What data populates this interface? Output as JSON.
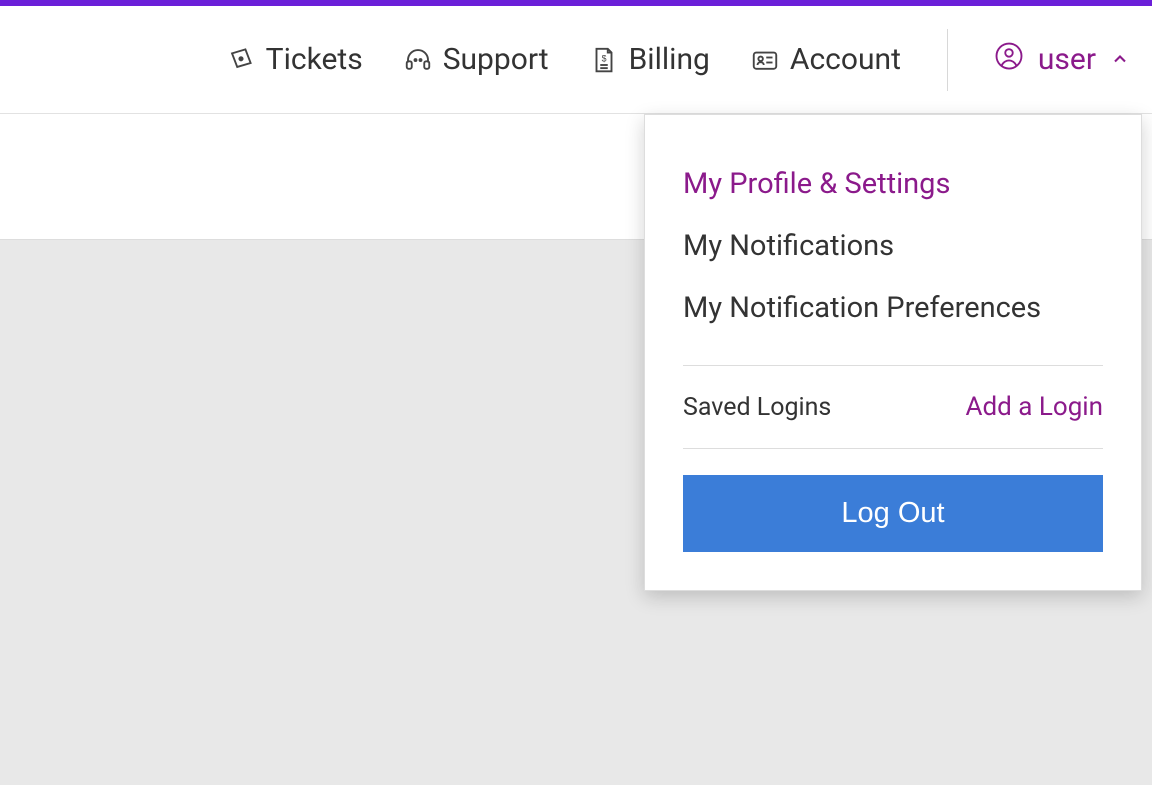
{
  "colors": {
    "accent": "#6b1fd8",
    "brand": "#8b1a8b",
    "button": "#3b7dd8"
  },
  "nav": {
    "tickets": "Tickets",
    "support": "Support",
    "billing": "Billing",
    "account": "Account"
  },
  "user": {
    "label": "user"
  },
  "dropdown": {
    "profile": "My Profile & Settings",
    "notifications": "My Notifications",
    "prefs": "My Notification Preferences",
    "saved_logins_label": "Saved Logins",
    "add_login": "Add a Login",
    "logout": "Log Out"
  }
}
